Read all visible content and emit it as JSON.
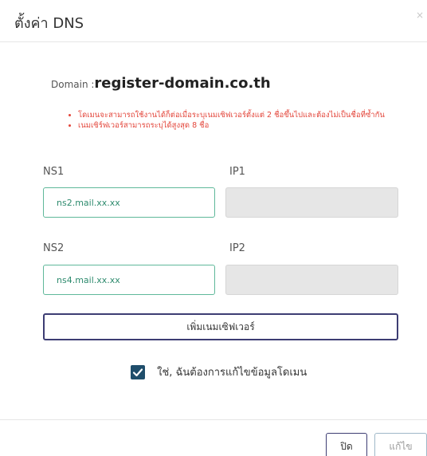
{
  "dialog": {
    "title": "ตั้งค่า DNS",
    "close_symbol": "×"
  },
  "domain": {
    "label": "Domain :",
    "value": "register-domain.co.th"
  },
  "notes": [
    "โดเมนจะสามารถใช้งานได้ก็ต่อเมื่อระบุเนมเซิฟเวอร์ตั้งแต่ 2 ชื่อขึ้นไปและต้องไม่เป็นชื่อที่ซ้ำกัน",
    "เนมเซิร์ฟเวอร์สามารถระบุได้สูงสุด 8 ชื่อ"
  ],
  "nameservers": [
    {
      "ns_label": "NS1",
      "ns_value": "ns2.mail.xx.xx",
      "ip_label": "IP1",
      "ip_value": ""
    },
    {
      "ns_label": "NS2",
      "ns_value": "ns4.mail.xx.xx",
      "ip_label": "IP2",
      "ip_value": ""
    }
  ],
  "add_ns_button": "เพิ่มเนมเซิฟเวอร์",
  "confirm": {
    "checked": true,
    "label": "ใช่, ฉันต้องการแก้ไขข้อมูลโดเมน"
  },
  "footer": {
    "close_label": "ปิด",
    "edit_label": "แก้ไข"
  },
  "colors": {
    "note_text": "#e3453a",
    "input_border": "#5fb89a",
    "button_border": "#3d3d73",
    "checkbox_fill": "#1f4e6b",
    "disabled_fill": "#e6e6e6"
  }
}
